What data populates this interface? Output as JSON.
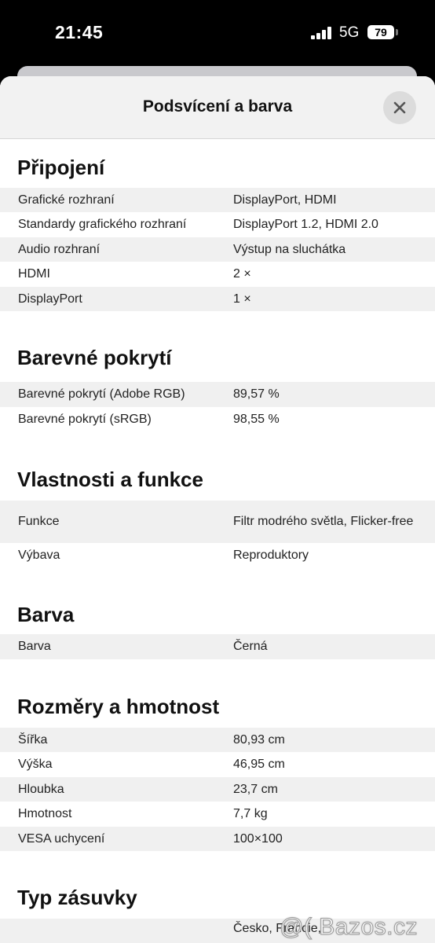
{
  "status_bar": {
    "time": "21:45",
    "network": "5G",
    "battery": "79"
  },
  "header": {
    "title": "Podsvícení a barva"
  },
  "sections": [
    {
      "title": "Připojení",
      "rows": [
        {
          "label": "Grafické rozhraní",
          "value": "DisplayPort, HDMI"
        },
        {
          "label": "Standardy grafického rozhraní",
          "value": "DisplayPort 1.2, HDMI 2.0"
        },
        {
          "label": "Audio rozhraní",
          "value": "Výstup na sluchátka"
        },
        {
          "label": "HDMI",
          "value": "2 ×"
        },
        {
          "label": "DisplayPort",
          "value": "1 ×"
        }
      ]
    },
    {
      "title": "Barevné pokrytí",
      "rows": [
        {
          "label": "Barevné pokrytí (Adobe RGB)",
          "value": "89,57 %"
        },
        {
          "label": "Barevné pokrytí (sRGB)",
          "value": "98,55 %"
        }
      ]
    },
    {
      "title": "Vlastnosti a funkce",
      "rows": [
        {
          "label": "Funkce",
          "value": "Filtr modrého světla, Flicker-free"
        },
        {
          "label": "Výbava",
          "value": "Reproduktory"
        }
      ]
    },
    {
      "title": "Barva",
      "rows": [
        {
          "label": "Barva",
          "value": "Černá"
        }
      ]
    },
    {
      "title": "Rozměry a hmotnost",
      "rows": [
        {
          "label": "Šířka",
          "value": "80,93 cm"
        },
        {
          "label": "Výška",
          "value": "46,95 cm"
        },
        {
          "label": "Hloubka",
          "value": "23,7 cm"
        },
        {
          "label": "Hmotnost",
          "value": "7,7 kg"
        },
        {
          "label": "VESA uchycení",
          "value": "100×100"
        }
      ]
    },
    {
      "title": "Typ zásuvky",
      "rows": [
        {
          "label": "",
          "value": "Česko, Francie,"
        }
      ]
    }
  ],
  "watermark": "@( Bazos.cz"
}
